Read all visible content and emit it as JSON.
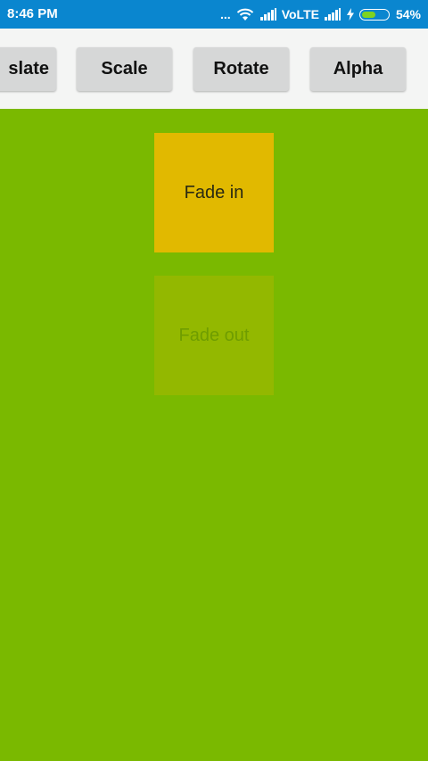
{
  "status_bar": {
    "time": "8:46 PM",
    "notification_dots": "...",
    "network_label": "VoLTE",
    "battery_percent": "54%",
    "battery_level": 0.54,
    "battery_fill_color": "#7ed321",
    "background_color": "#0a86cf"
  },
  "toolbar": {
    "buttons": [
      {
        "label": "slate",
        "full_label_hint": "Translate (clipped)"
      },
      {
        "label": "Scale"
      },
      {
        "label": "Rotate"
      },
      {
        "label": "Alpha"
      }
    ]
  },
  "content": {
    "background_color": "#7ab900",
    "fade_in": {
      "label": "Fade in",
      "color": "#e1b900"
    },
    "fade_out": {
      "label": "Fade out",
      "color": "#93b800"
    }
  }
}
